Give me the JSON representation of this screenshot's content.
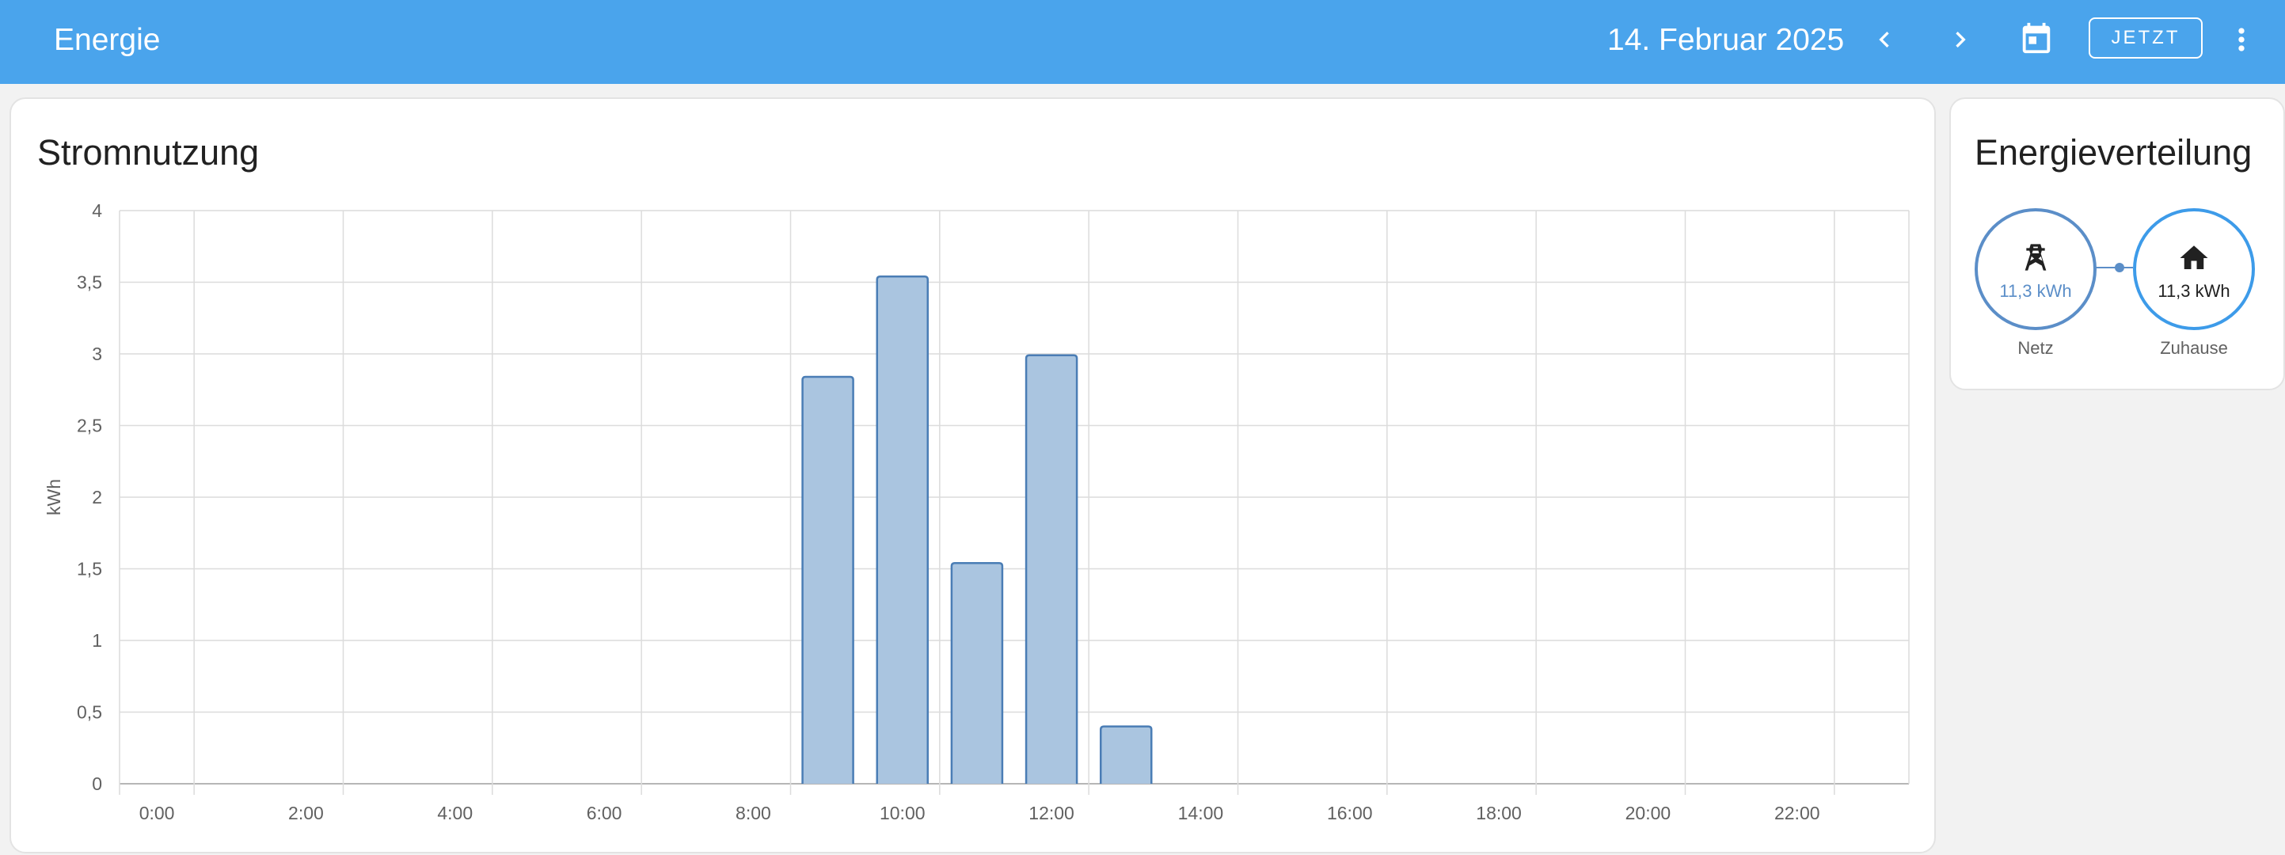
{
  "header": {
    "title": "Energie",
    "date": "14. Februar 2025",
    "now_label": "JETZT",
    "icons": [
      "chevron-left-icon",
      "chevron-right-icon",
      "calendar-icon",
      "more-vert-icon"
    ]
  },
  "usage_card": {
    "title": "Stromnutzung"
  },
  "distribution_card": {
    "title": "Energieverteilung",
    "grid": {
      "label": "Netz",
      "value": "11,3 kWh",
      "icon": "transmission-tower-icon"
    },
    "home": {
      "label": "Zuhause",
      "value": "11,3 kWh",
      "icon": "home-icon"
    }
  },
  "colors": {
    "header": "#4aa4ec",
    "bar_fill": "#aac5e0",
    "bar_stroke": "#4a7db5",
    "grid_value": "#5b8ec8",
    "home_ring": "#3d9be9"
  },
  "chart_data": {
    "type": "bar",
    "ylabel": "kWh",
    "xlabel": "",
    "ylim": [
      0,
      4
    ],
    "yticks": [
      "0",
      "0,5",
      "1",
      "1,5",
      "2",
      "2,5",
      "3",
      "3,5",
      "4"
    ],
    "xticks": [
      "0:00",
      "2:00",
      "4:00",
      "6:00",
      "8:00",
      "10:00",
      "12:00",
      "14:00",
      "16:00",
      "18:00",
      "20:00",
      "22:00"
    ],
    "categories": [
      "0:00",
      "1:00",
      "2:00",
      "3:00",
      "4:00",
      "5:00",
      "6:00",
      "7:00",
      "8:00",
      "9:00",
      "10:00",
      "11:00",
      "12:00",
      "13:00",
      "14:00",
      "15:00",
      "16:00",
      "17:00",
      "18:00",
      "19:00",
      "20:00",
      "21:00",
      "22:00",
      "23:00"
    ],
    "values": [
      0,
      0,
      0,
      0,
      0,
      0,
      0,
      0,
      0,
      2.84,
      3.54,
      1.54,
      2.99,
      0.4,
      0,
      0,
      0,
      0,
      0,
      0,
      0,
      0,
      0,
      0
    ],
    "grid": true,
    "legend": "none"
  }
}
